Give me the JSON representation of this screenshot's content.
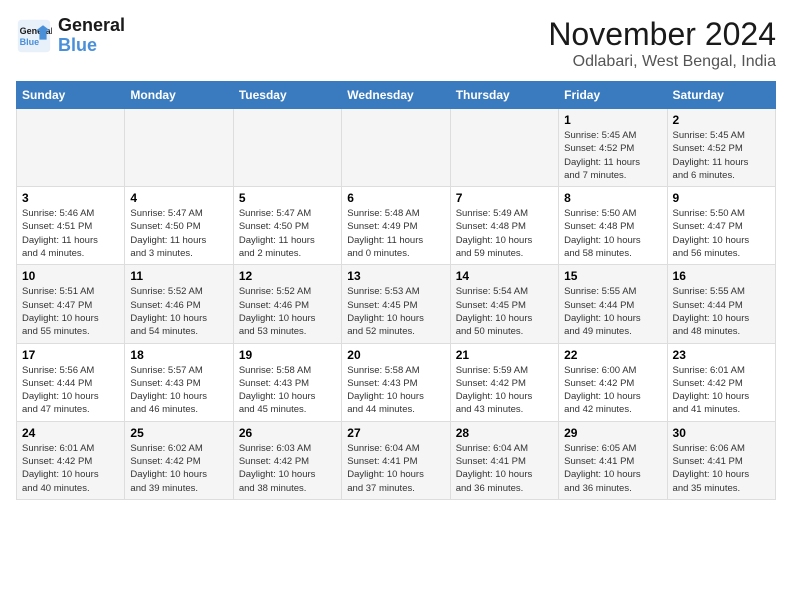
{
  "logo": {
    "name_line1": "General",
    "name_line2": "Blue"
  },
  "header": {
    "month": "November 2024",
    "location": "Odlabari, West Bengal, India"
  },
  "weekdays": [
    "Sunday",
    "Monday",
    "Tuesday",
    "Wednesday",
    "Thursday",
    "Friday",
    "Saturday"
  ],
  "rows": [
    {
      "cells": [
        {
          "day": "",
          "info": ""
        },
        {
          "day": "",
          "info": ""
        },
        {
          "day": "",
          "info": ""
        },
        {
          "day": "",
          "info": ""
        },
        {
          "day": "",
          "info": ""
        },
        {
          "day": "1",
          "info": "Sunrise: 5:45 AM\nSunset: 4:52 PM\nDaylight: 11 hours\nand 7 minutes."
        },
        {
          "day": "2",
          "info": "Sunrise: 5:45 AM\nSunset: 4:52 PM\nDaylight: 11 hours\nand 6 minutes."
        }
      ]
    },
    {
      "cells": [
        {
          "day": "3",
          "info": "Sunrise: 5:46 AM\nSunset: 4:51 PM\nDaylight: 11 hours\nand 4 minutes."
        },
        {
          "day": "4",
          "info": "Sunrise: 5:47 AM\nSunset: 4:50 PM\nDaylight: 11 hours\nand 3 minutes."
        },
        {
          "day": "5",
          "info": "Sunrise: 5:47 AM\nSunset: 4:50 PM\nDaylight: 11 hours\nand 2 minutes."
        },
        {
          "day": "6",
          "info": "Sunrise: 5:48 AM\nSunset: 4:49 PM\nDaylight: 11 hours\nand 0 minutes."
        },
        {
          "day": "7",
          "info": "Sunrise: 5:49 AM\nSunset: 4:48 PM\nDaylight: 10 hours\nand 59 minutes."
        },
        {
          "day": "8",
          "info": "Sunrise: 5:50 AM\nSunset: 4:48 PM\nDaylight: 10 hours\nand 58 minutes."
        },
        {
          "day": "9",
          "info": "Sunrise: 5:50 AM\nSunset: 4:47 PM\nDaylight: 10 hours\nand 56 minutes."
        }
      ]
    },
    {
      "cells": [
        {
          "day": "10",
          "info": "Sunrise: 5:51 AM\nSunset: 4:47 PM\nDaylight: 10 hours\nand 55 minutes."
        },
        {
          "day": "11",
          "info": "Sunrise: 5:52 AM\nSunset: 4:46 PM\nDaylight: 10 hours\nand 54 minutes."
        },
        {
          "day": "12",
          "info": "Sunrise: 5:52 AM\nSunset: 4:46 PM\nDaylight: 10 hours\nand 53 minutes."
        },
        {
          "day": "13",
          "info": "Sunrise: 5:53 AM\nSunset: 4:45 PM\nDaylight: 10 hours\nand 52 minutes."
        },
        {
          "day": "14",
          "info": "Sunrise: 5:54 AM\nSunset: 4:45 PM\nDaylight: 10 hours\nand 50 minutes."
        },
        {
          "day": "15",
          "info": "Sunrise: 5:55 AM\nSunset: 4:44 PM\nDaylight: 10 hours\nand 49 minutes."
        },
        {
          "day": "16",
          "info": "Sunrise: 5:55 AM\nSunset: 4:44 PM\nDaylight: 10 hours\nand 48 minutes."
        }
      ]
    },
    {
      "cells": [
        {
          "day": "17",
          "info": "Sunrise: 5:56 AM\nSunset: 4:44 PM\nDaylight: 10 hours\nand 47 minutes."
        },
        {
          "day": "18",
          "info": "Sunrise: 5:57 AM\nSunset: 4:43 PM\nDaylight: 10 hours\nand 46 minutes."
        },
        {
          "day": "19",
          "info": "Sunrise: 5:58 AM\nSunset: 4:43 PM\nDaylight: 10 hours\nand 45 minutes."
        },
        {
          "day": "20",
          "info": "Sunrise: 5:58 AM\nSunset: 4:43 PM\nDaylight: 10 hours\nand 44 minutes."
        },
        {
          "day": "21",
          "info": "Sunrise: 5:59 AM\nSunset: 4:42 PM\nDaylight: 10 hours\nand 43 minutes."
        },
        {
          "day": "22",
          "info": "Sunrise: 6:00 AM\nSunset: 4:42 PM\nDaylight: 10 hours\nand 42 minutes."
        },
        {
          "day": "23",
          "info": "Sunrise: 6:01 AM\nSunset: 4:42 PM\nDaylight: 10 hours\nand 41 minutes."
        }
      ]
    },
    {
      "cells": [
        {
          "day": "24",
          "info": "Sunrise: 6:01 AM\nSunset: 4:42 PM\nDaylight: 10 hours\nand 40 minutes."
        },
        {
          "day": "25",
          "info": "Sunrise: 6:02 AM\nSunset: 4:42 PM\nDaylight: 10 hours\nand 39 minutes."
        },
        {
          "day": "26",
          "info": "Sunrise: 6:03 AM\nSunset: 4:42 PM\nDaylight: 10 hours\nand 38 minutes."
        },
        {
          "day": "27",
          "info": "Sunrise: 6:04 AM\nSunset: 4:41 PM\nDaylight: 10 hours\nand 37 minutes."
        },
        {
          "day": "28",
          "info": "Sunrise: 6:04 AM\nSunset: 4:41 PM\nDaylight: 10 hours\nand 36 minutes."
        },
        {
          "day": "29",
          "info": "Sunrise: 6:05 AM\nSunset: 4:41 PM\nDaylight: 10 hours\nand 36 minutes."
        },
        {
          "day": "30",
          "info": "Sunrise: 6:06 AM\nSunset: 4:41 PM\nDaylight: 10 hours\nand 35 minutes."
        }
      ]
    }
  ]
}
